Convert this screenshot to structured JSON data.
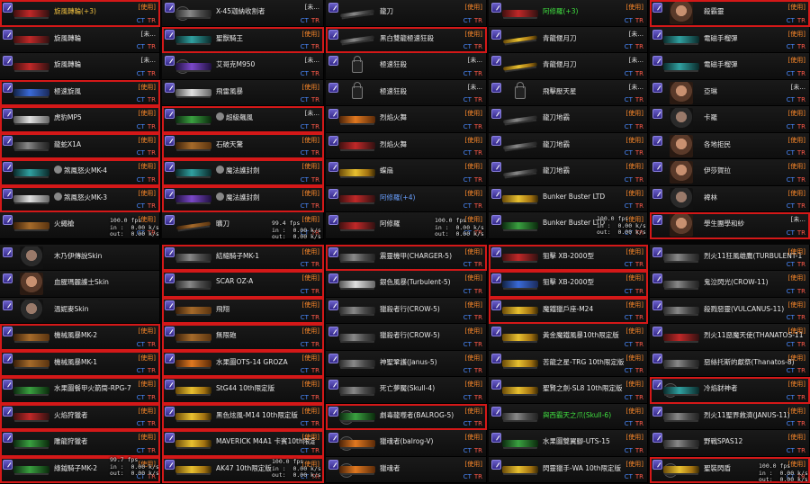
{
  "labels": {
    "ct": "CT",
    "tr": "TR"
  },
  "columns": [
    {
      "items": [
        {
          "name": "旋風轉輪(+3)",
          "status": "[使用]",
          "thumb": "gun",
          "color": "red",
          "sel": true,
          "tint": "gold"
        },
        {
          "name": "旋風轉輪",
          "status": "[未...",
          "thumb": "gun",
          "color": "red"
        },
        {
          "name": "旋風轉輪",
          "status": "[未...",
          "thumb": "gun",
          "color": "red"
        },
        {
          "name": "極速旋風",
          "status": "[使用]",
          "thumb": "gun",
          "color": "blue",
          "sel": true
        },
        {
          "name": "虎豹MP5",
          "status": "[使用]",
          "thumb": "gun",
          "color": "white",
          "sel": true
        },
        {
          "name": "龍蛇X1A",
          "status": "[使用]",
          "thumb": "gun",
          "color": "",
          "sel": true
        },
        {
          "name": "煞鳳怒火MK-4",
          "status": "[使用]",
          "thumb": "gun",
          "color": "teal",
          "sel": true,
          "tagged": true
        },
        {
          "name": "煞鳳怒火MK-3",
          "status": "[使用]",
          "thumb": "gun",
          "color": "white",
          "sel": true,
          "tagged": true
        },
        {
          "name": "火繩槍",
          "status": "[使用]",
          "thumb": "gun",
          "color": "wood"
        },
        {
          "name": "木乃伊傳說Skin",
          "status": "",
          "thumb": "face",
          "color": "dark",
          "wh": true
        },
        {
          "name": "血腥瑪麗護士Skin",
          "status": "",
          "thumb": "face",
          "color": "",
          "wh": true
        },
        {
          "name": "溫妮麥Skin",
          "status": "",
          "thumb": "face",
          "color": "dark",
          "wh": true
        },
        {
          "name": "機械風暴MK-2",
          "status": "[使用]",
          "thumb": "gun",
          "color": "wood",
          "sel": true
        },
        {
          "name": "機械風暴MK-1",
          "status": "[使用]",
          "thumb": "gun",
          "color": "wood",
          "sel": true
        },
        {
          "name": "水果圖餐甲火箭筒-RPG-7",
          "status": "[使用]",
          "thumb": "gun",
          "color": "green",
          "sel": true
        },
        {
          "name": "火焰狩獵者",
          "status": "[使用]",
          "thumb": "gun",
          "color": "red",
          "sel": true
        },
        {
          "name": "雕龍狩獵者",
          "status": "[使用]",
          "thumb": "gun",
          "color": "green",
          "sel": true
        },
        {
          "name": "綠鉞騎子MK-2",
          "status": "[使用]",
          "thumb": "gun",
          "color": "green",
          "sel": true
        }
      ]
    },
    {
      "items": [
        {
          "name": "X-45迦納收割者",
          "status": "[未...",
          "thumb": "gun",
          "color": "",
          "circ": true
        },
        {
          "name": "聖獸騎王",
          "status": "[使用]",
          "thumb": "gun",
          "color": "teal",
          "sel": true
        },
        {
          "name": "艾哥克M950",
          "status": "[未...",
          "thumb": "gun",
          "color": "purple",
          "circ": true
        },
        {
          "name": "飛雷風暴",
          "status": "[使用]",
          "thumb": "gun",
          "color": "white"
        },
        {
          "name": "超級飆風",
          "status": "[未...",
          "thumb": "gun",
          "color": "green",
          "sel": true,
          "tagged": true
        },
        {
          "name": "石破天驚",
          "status": "[使用]",
          "thumb": "gun",
          "color": "wood",
          "sel": true
        },
        {
          "name": "魔法護封劍",
          "status": "[使用]",
          "thumb": "gun",
          "color": "teal",
          "sel": true,
          "tagged": true
        },
        {
          "name": "魔法護封劍",
          "status": "[使用]",
          "thumb": "gun",
          "color": "purple",
          "sel": true,
          "tagged": true
        },
        {
          "name": "曠刀",
          "status": "[使用]",
          "thumb": "gun",
          "color": "wood",
          "knife": true
        },
        {
          "name": "結縮騎子MK-1",
          "status": "[使用]",
          "thumb": "gun",
          "color": "",
          "sel": true
        },
        {
          "name": "SCAR OZ-A",
          "status": "[使用]",
          "thumb": "gun",
          "color": "",
          "sel": true
        },
        {
          "name": "飛翔",
          "status": "[使用]",
          "thumb": "gun",
          "color": "wood",
          "sel": true
        },
        {
          "name": "無限砲",
          "status": "[使用]",
          "thumb": "gun",
          "color": "wood",
          "sel": true
        },
        {
          "name": "水果圖OTS-14 GROZA",
          "status": "[使用]",
          "thumb": "gun",
          "color": "orange",
          "sel": true
        },
        {
          "name": "StG44 10th限定版",
          "status": "[使用]",
          "thumb": "gun",
          "color": "gold",
          "sel": true
        },
        {
          "name": "黑色炫風-M14 10th限定版",
          "status": "[使用]",
          "thumb": "gun",
          "color": "gold",
          "sel": true
        },
        {
          "name": "MAVERICK M4A1 卡賓10th限定版",
          "status": "[使用]",
          "thumb": "gun",
          "color": "gold",
          "sel": true
        },
        {
          "name": "AK47 10th限定版",
          "status": "[使用]",
          "thumb": "gun",
          "color": "gold",
          "sel": true
        }
      ]
    },
    {
      "items": [
        {
          "name": "龍刀",
          "status": "[使用]",
          "thumb": "gun",
          "color": "",
          "knife": true
        },
        {
          "name": "黑白雙龍極速狂殺",
          "status": "[使用]",
          "thumb": "gun",
          "color": "",
          "sel": true,
          "knife": true
        },
        {
          "name": "極速狂殺",
          "status": "[未...",
          "thumb": "lock",
          "color": ""
        },
        {
          "name": "極速狂殺",
          "status": "[未...",
          "thumb": "lock",
          "color": ""
        },
        {
          "name": "烈焰火舞",
          "status": "[使用]",
          "thumb": "gun",
          "color": "orange"
        },
        {
          "name": "烈焰火舞",
          "status": "[使用]",
          "thumb": "gun",
          "color": "red"
        },
        {
          "name": "蝶扇",
          "status": "[使用]",
          "thumb": "gun",
          "color": "gold"
        },
        {
          "name": "阿修羅(+4)",
          "status": "[使用]",
          "thumb": "gun",
          "color": "red",
          "nameColor": "blue"
        },
        {
          "name": "阿修羅",
          "status": "[使用]",
          "thumb": "gun",
          "color": "red"
        },
        {
          "name": "震靈機甲(CHARGER-5)",
          "status": "[使用]",
          "thumb": "gun",
          "color": "",
          "sel": true
        },
        {
          "name": "銀色風暴(Turbulent-5)",
          "status": "[使用]",
          "thumb": "gun",
          "color": "white"
        },
        {
          "name": "獵殺者行(CROW-5)",
          "status": "[使用]",
          "thumb": "gun",
          "color": ""
        },
        {
          "name": "獵殺者行(CROW-5)",
          "status": "[使用]",
          "thumb": "gun",
          "color": ""
        },
        {
          "name": "神聖鞏護(Janus-5)",
          "status": "[使用]",
          "thumb": "gun",
          "color": ""
        },
        {
          "name": "死亡夢魘(Skull-4)",
          "status": "[使用]",
          "thumb": "gun",
          "color": ""
        },
        {
          "name": "劇毒龍噬者(BALROG-5)",
          "status": "[使用]",
          "thumb": "gun",
          "color": "green",
          "sel": true,
          "circ": true
        },
        {
          "name": "獵魂者(balrog-V)",
          "status": "[使用]",
          "thumb": "gun",
          "color": "orange",
          "circ": true
        },
        {
          "name": "獵魂者",
          "status": "[使用]",
          "thumb": "gun",
          "color": "orange",
          "circ": true
        }
      ]
    },
    {
      "items": [
        {
          "name": "阿修羅(+3)",
          "status": "[使用]",
          "thumb": "gun",
          "color": "red",
          "nameColor": "green"
        },
        {
          "name": "青龍偃月刀",
          "status": "[未...",
          "thumb": "gun",
          "color": "gold",
          "knife": true
        },
        {
          "name": "青龍偃月刀",
          "status": "[未...",
          "thumb": "gun",
          "color": "gold",
          "knife": true
        },
        {
          "name": "飛擊壓天星",
          "status": "[未...",
          "thumb": "lock",
          "color": ""
        },
        {
          "name": "龍刀地霸",
          "status": "[使用]",
          "thumb": "gun",
          "color": "",
          "knife": true
        },
        {
          "name": "龍刀地霸",
          "status": "[使用]",
          "thumb": "gun",
          "color": "",
          "knife": true
        },
        {
          "name": "龍刀地霸",
          "status": "[使用]",
          "thumb": "gun",
          "color": "",
          "knife": true
        },
        {
          "name": "Bunker Buster LTD",
          "status": "[使用]",
          "thumb": "gun",
          "color": "gold"
        },
        {
          "name": "Bunker Buster LTD",
          "status": "[使用]",
          "thumb": "gun",
          "color": "green"
        },
        {
          "name": "狙擊 XB-2000型",
          "status": "[使用]",
          "thumb": "gun",
          "color": "red",
          "sel": true
        },
        {
          "name": "狙擊 XB-2000型",
          "status": "[使用]",
          "thumb": "gun",
          "color": "blue",
          "sel": true
        },
        {
          "name": "魔鐵獵戶座-M24",
          "status": "[使用]",
          "thumb": "gun",
          "color": "gold",
          "sel": true
        },
        {
          "name": "黃金魔鐵風暴10th限定版",
          "status": "[使用]",
          "thumb": "gun",
          "color": "gold"
        },
        {
          "name": "苦龍之星-TRG 10th限定版",
          "status": "[使用]",
          "thumb": "gun",
          "color": "gold"
        },
        {
          "name": "聖賢之劍-SL8 10th限定版",
          "status": "[使用]",
          "thumb": "gun",
          "color": "gold"
        },
        {
          "name": "與西霸天之爪(Skull-6)",
          "status": "[使用]",
          "thumb": "gun",
          "color": "",
          "nameColor": "green"
        },
        {
          "name": "水果圖雙翼腳-UTS-15",
          "status": "[使用]",
          "thumb": "gun",
          "color": "green"
        },
        {
          "name": "閃靈獵手-WA 10th限定版",
          "status": "[使用]",
          "thumb": "gun",
          "color": "gold"
        }
      ]
    },
    {
      "items": [
        {
          "name": "殺霸靈",
          "status": "[使用]",
          "thumb": "face",
          "color": "",
          "sel": true
        },
        {
          "name": "電磁手榴彈",
          "status": "[使用]",
          "thumb": "gun",
          "color": "teal"
        },
        {
          "name": "電磁手榴彈",
          "status": "[使用]",
          "thumb": "gun",
          "color": "teal"
        },
        {
          "name": "亞琳",
          "status": "[未...",
          "thumb": "face",
          "color": ""
        },
        {
          "name": "卡羅",
          "status": "[使用]",
          "thumb": "face",
          "color": "dark"
        },
        {
          "name": "各地拒民",
          "status": "[使用]",
          "thumb": "face",
          "color": ""
        },
        {
          "name": "伊莎賀拉",
          "status": "[使用]",
          "thumb": "face",
          "color": ""
        },
        {
          "name": "裨林",
          "status": "[使用]",
          "thumb": "face",
          "color": "dark"
        },
        {
          "name": "學生團學和紗",
          "status": "[未...",
          "thumb": "face",
          "color": "",
          "sel": true
        },
        {
          "name": "烈火11狂風雄鷹(TURBULENT-11)",
          "status": "[使用]",
          "thumb": "gun",
          "color": ""
        },
        {
          "name": "鬼泣閃光(CROW-11)",
          "status": "[使用]",
          "thumb": "gun",
          "color": ""
        },
        {
          "name": "殺戮惡靈(VULCANUS-11)",
          "status": "[使用]",
          "thumb": "gun",
          "color": ""
        },
        {
          "name": "烈火11惡魔天使(THANATOS-11)",
          "status": "[使用]",
          "thumb": "gun",
          "color": "red"
        },
        {
          "name": "惡絲托斯的獻祭(Thanatos-8)",
          "status": "[使用]",
          "thumb": "gun",
          "color": ""
        },
        {
          "name": "冷焰豺神者",
          "status": "[使用]",
          "thumb": "gun",
          "color": "teal",
          "sel": true,
          "circ": true
        },
        {
          "name": "烈火11聖界救濟(JANUS-11)",
          "status": "[使用]",
          "thumb": "gun",
          "color": ""
        },
        {
          "name": "野戰SPAS12",
          "status": "[使用]",
          "thumb": "gun",
          "color": ""
        },
        {
          "name": "聖裝閃盾",
          "status": "[使用]",
          "thumb": "gun",
          "color": "gold",
          "sel": true,
          "circ": true
        }
      ]
    }
  ],
  "hud": [
    {
      "text": "100.0 fps\nin :  0.00 k/s\nout:  0.00 k/s"
    },
    {
      "text": "99.4 fps\nin :  0.00 k/s\nout:  0.00 k/s"
    },
    {
      "text": "100.0 fps\nin :  0.00 k/s\nout:  0.00 k/s"
    },
    {
      "text": "100.0 fps\nin :  0.00 k/s\nout:  0.00 k/s"
    },
    {
      "text": "99.7 fps\nin :  0.00 k/s\nout:  0.00 k/s"
    },
    {
      "text": "100.0 fps\nin :  0.00 k/s\nout:  0.00 k/s"
    },
    {
      "text": "100.0 fps\nin :  0.00 k/s\nout:  0.00 k/s"
    }
  ]
}
